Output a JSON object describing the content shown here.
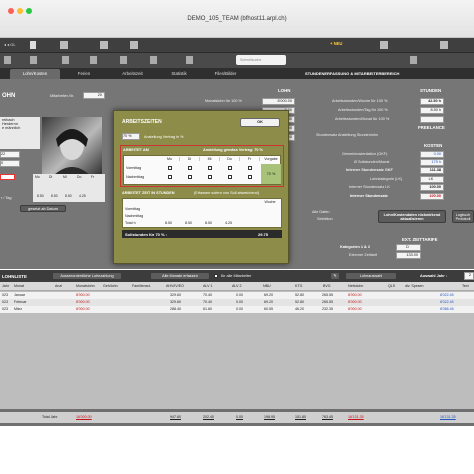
{
  "window": {
    "title": "DEMO_105_TEAM (bfhost11.arpl.ch)"
  },
  "toolbar": {
    "new_label": "+ NEU",
    "search_placeholder": "Schnellsuche"
  },
  "tabs": [
    {
      "label": "Lohn/Kosten"
    },
    {
      "label": "Ferien"
    },
    {
      "label": "Arbeitszeit"
    },
    {
      "label": "Statistik"
    },
    {
      "label": "Files/Bilder"
    }
  ],
  "section_right_title": "STUNDENERFASSUNG & MITARBEITERBEREICH",
  "left_panel": {
    "heading": "OHN",
    "employee_no_label": "Mitarbeiter-Nr.",
    "employee_no": "20",
    "name_lines": [
      "reibach",
      "Herdernn",
      "e männlich"
    ],
    "year": "22",
    "date": "0",
    "mini_days": [
      "Mo",
      "Di",
      "Mi",
      "Do",
      "Fr"
    ],
    "hours_row": [
      "8.50",
      "8.50",
      "8.50",
      "4.25"
    ],
    "per_day_label": "r / Tag",
    "status": "gesetzt ab Datum"
  },
  "center_fields": {
    "header": "LOHN",
    "monthly_label": "Monatslohn für 100 %",
    "monthly_value": "8'000.00",
    "rows": [
      {
        "label": "",
        "value": "0.00"
      },
      {
        "label": "",
        "value": "0.00"
      },
      {
        "label": "",
        "value": "0.00"
      },
      {
        "label": "",
        "value": "0.00"
      }
    ]
  },
  "right_panel": {
    "stunden_header": "STUNDEN",
    "rows": [
      {
        "label": "Arbeitsstunden/Woche für 100 %",
        "value": "42.50 h"
      },
      {
        "label": "Arbeitsstunden/Tag für 100 %",
        "value": "8.50 h"
      },
      {
        "label": "Arbeitsstunden/Monat für 100 %",
        "value": ""
      }
    ],
    "freelance_header": "FREELANCE",
    "freelance_label": "Stundensatz Anstellung Stundenlohn",
    "kosten_header": "KOSTEN",
    "kosten_rows": [
      {
        "label": "Gemeinkostenfaktor (GKF)",
        "value": "0.00"
      },
      {
        "label": "Ø Sollstunden/Monat",
        "value": "179 h"
      },
      {
        "label": "Interner Stundensatz GKF",
        "value": "111.38"
      },
      {
        "label": "Lohnkategorie (LK)",
        "value": "LK"
      },
      {
        "label": "Interner Stundensatz LK",
        "value": "100.00"
      },
      {
        "label": "Interner Stundensatz",
        "value": "100.00"
      }
    ],
    "all_data_label": "Alle Daten",
    "selected_label": "Selektion",
    "action_button": "Lohn/Kostendaten rückwirkend aktualisieren",
    "logbook_button": "Logbuch Protokoll",
    "ext_header": "EXT. ZEITTARIFE",
    "cat_label": "Kategorien 1 & 2",
    "cat_value": "D",
    "ext_rate_label": "Externer Zeittarif",
    "ext_rate_value": "133.00"
  },
  "dialog": {
    "title": "ARBEITSZEITEN",
    "ok_label": "OK",
    "percent_value": "70 %",
    "percent_label": "Anstellung Vertrag in %",
    "am_header": "ARBEITET AM",
    "am_note": "Anstellung gemäss Vertrag: 70 %",
    "days": [
      "Mo",
      "Di",
      "Mi",
      "Do",
      "Fr"
    ],
    "vorgabe_label": "Vorgabe",
    "vormittag_label": "Vormittag",
    "nachmittag_label": "Nachmittag",
    "vorgabe_value": "70 %",
    "hours_header": "ARBEITET ZEIT IN STUNDEN",
    "hours_note": "(Erfassen sofern von Soll abweichend)",
    "woche_label": "Woche",
    "total_label": "Total h",
    "totals": [
      "8.50",
      "8.50",
      "8.50",
      "4.25"
    ],
    "soll_label": "Sollstunden für 70 % :",
    "soll_value": "29.75"
  },
  "list": {
    "title": "LOHNLISTE",
    "add_button": "Ausserordentliche Lohnzahlung",
    "open_button": "Alle Monate erfassen",
    "all_employees_label": "für alle Mitarbeiter",
    "wage_button": "Lohnauswahl",
    "year_label": "Auswahl Jahr :",
    "year_value": "2",
    "columns": [
      "Jahr",
      "Monat",
      "Anzl",
      "Monatslohn",
      "Geh/lohn",
      "Familienzul.",
      "AHV/IV/EO",
      "ALV 1",
      "ALV 2",
      "NBU",
      "KTG",
      "BVG",
      "Nettolohn",
      "QLS",
      "div. Spesen",
      "Text"
    ],
    "rows": [
      {
        "year": "023",
        "month": "Januar",
        "monatslohn": "8'000.00",
        "ahv": "329.60",
        "alv1": "70.40",
        "alv2": "0.00",
        "nbu": "69.20",
        "ktg": "52.80",
        "bvg": "265.55",
        "netto": "8'000.00",
        "spesen": "8'022.45"
      },
      {
        "year": "023",
        "month": "Februar",
        "monatslohn": "8'000.00",
        "ahv": "329.60",
        "alv1": "70.40",
        "alv2": "0.00",
        "nbu": "69.20",
        "ktg": "52.80",
        "bvg": "265.55",
        "netto": "8'000.00",
        "spesen": "8'022.45"
      },
      {
        "year": "023",
        "month": "März",
        "monatslohn": "8'000.00",
        "ahv": "288.40",
        "alv1": "61.60",
        "alv2": "0.00",
        "nbu": "60.55",
        "ktg": "46.20",
        "bvg": "232.35",
        "netto": "8'000.00",
        "spesen": "8'086.45"
      }
    ],
    "total_label": "Total Jahr",
    "totals": {
      "monatslohn": "16'000.00",
      "ahv": "947.60",
      "alv1": "202.40",
      "alv2": "0.00",
      "nbu": "198.95",
      "ktg": "151.80",
      "bvg": "763.45",
      "netto": "16'131.35",
      "spesen": "16'131.35"
    }
  },
  "colors": {
    "dialog_bg": "#8d8c49",
    "main_bg": "#767676",
    "red": "#c0171a",
    "blue": "#2455c4"
  }
}
